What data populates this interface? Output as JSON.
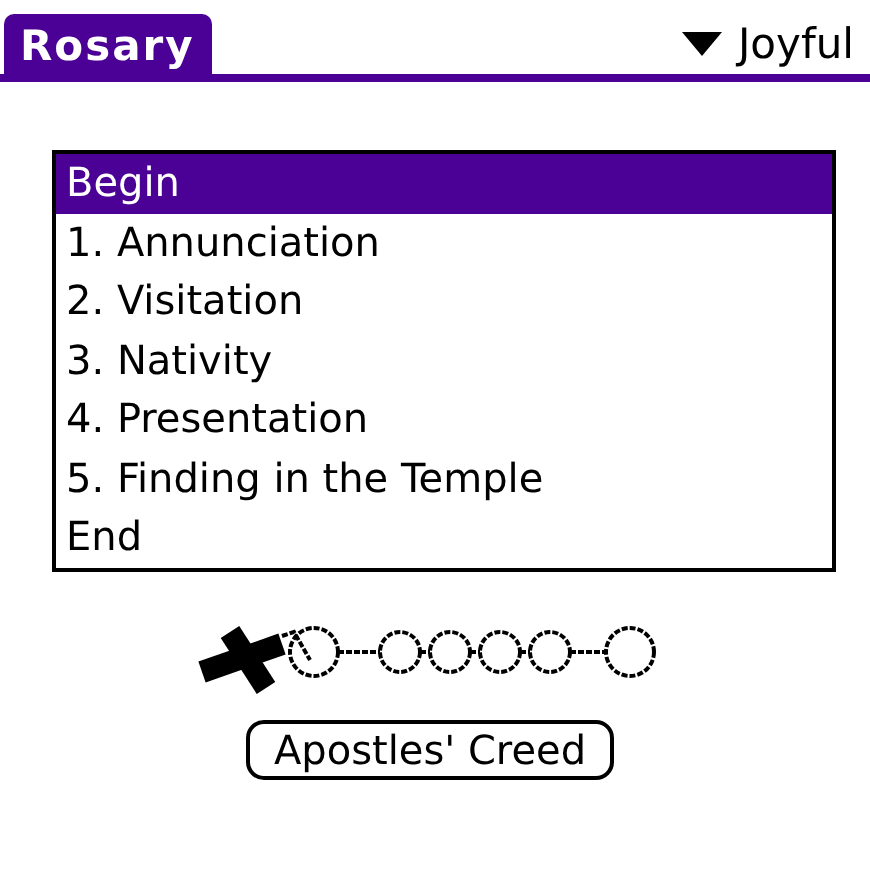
{
  "title": "Rosary",
  "mystery_picker": {
    "value": "Joyful"
  },
  "list": [
    {
      "label": "Begin",
      "selected": true
    },
    {
      "label": "1. Annunciation",
      "selected": false
    },
    {
      "label": "2. Visitation",
      "selected": false
    },
    {
      "label": "3. Nativity",
      "selected": false
    },
    {
      "label": "4. Presentation",
      "selected": false
    },
    {
      "label": "5. Finding in the Temple",
      "selected": false
    },
    {
      "label": "End",
      "selected": false
    }
  ],
  "prayer_button": "Apostles' Creed"
}
